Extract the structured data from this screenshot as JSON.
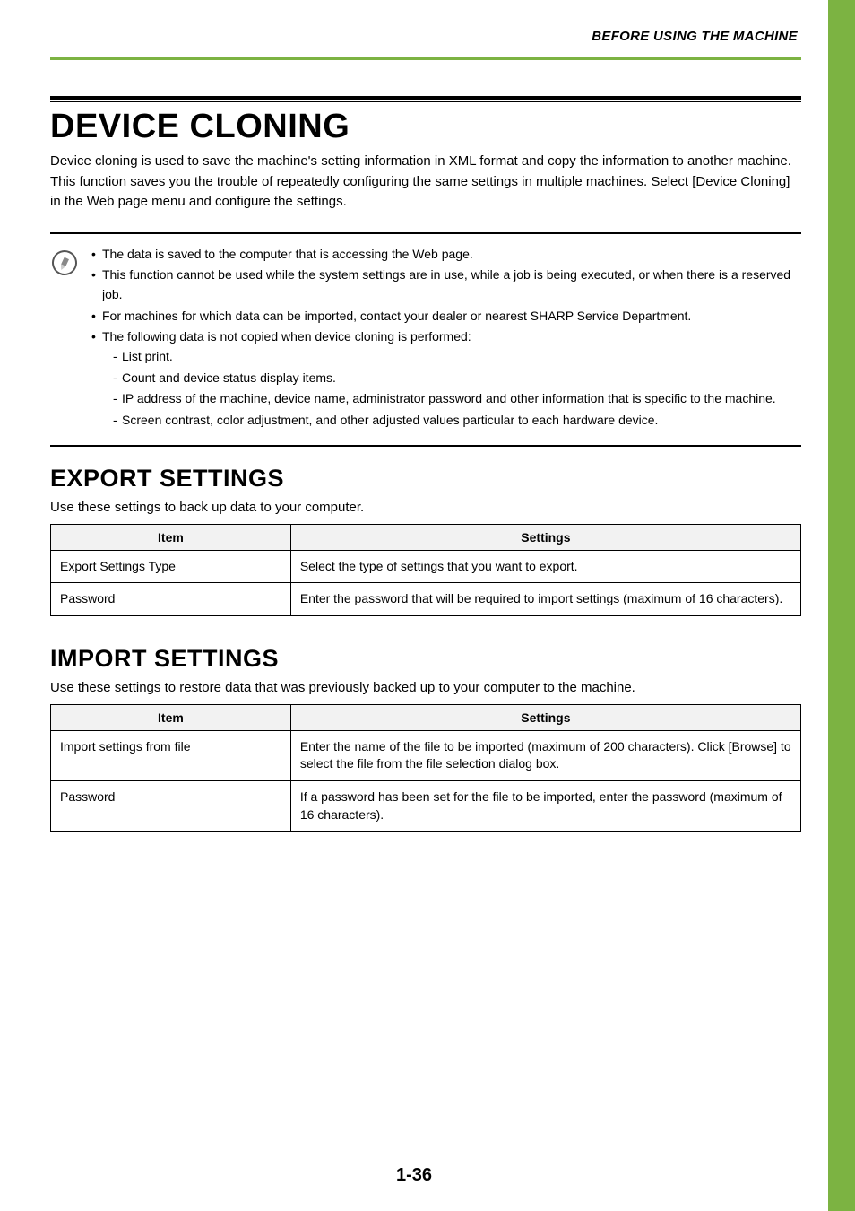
{
  "header": {
    "running_head": "BEFORE USING THE MACHINE"
  },
  "main": {
    "title": "DEVICE CLONING",
    "intro": "Device cloning is used to save the machine's setting information in XML format and copy the information to another machine.\nThis function saves you the trouble of repeatedly configuring the same settings in multiple machines. Select [Device Cloning] in the Web page menu and configure the settings."
  },
  "notes": {
    "items": [
      "The data is saved to the computer that is accessing the Web page.",
      "This function cannot be used while the system settings are in use, while a job is being executed, or when there is a reserved job.",
      "For machines for which data can be imported, contact your dealer or nearest SHARP Service Department.",
      "The following data is not copied when device cloning is performed:"
    ],
    "sub_items": [
      "List print.",
      "Count and device status display items.",
      "IP address of the machine, device name, administrator password and other information that is specific to the machine.",
      "Screen contrast, color adjustment, and other adjusted values particular to each hardware device."
    ]
  },
  "export": {
    "title": "EXPORT SETTINGS",
    "desc": "Use these settings to back up data to your computer.",
    "headers": {
      "item": "Item",
      "settings": "Settings"
    },
    "rows": [
      {
        "item": "Export Settings Type",
        "settings": "Select the type of settings that you want to export."
      },
      {
        "item": "Password",
        "settings": "Enter the password that will be required to import settings (maximum of 16 characters)."
      }
    ]
  },
  "import": {
    "title": "IMPORT SETTINGS",
    "desc": "Use these settings to restore data that was previously backed up to your computer to the machine.",
    "headers": {
      "item": "Item",
      "settings": "Settings"
    },
    "rows": [
      {
        "item": "Import settings from file",
        "settings": "Enter the name of the file to be imported (maximum of 200 characters). Click [Browse] to select the file from the file selection dialog box."
      },
      {
        "item": "Password",
        "settings": "If a password has been set for the file to be imported, enter the password (maximum of 16 characters)."
      }
    ]
  },
  "footer": {
    "page_number": "1-36"
  }
}
